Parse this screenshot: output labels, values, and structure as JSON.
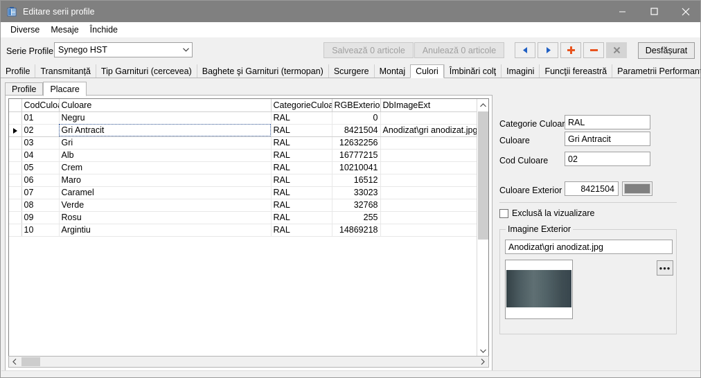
{
  "window": {
    "title": "Editare serii profile",
    "icon": "app-icon",
    "minimize": "minimize-icon",
    "maximize": "maximize-icon",
    "close": "close-icon"
  },
  "menubar": {
    "items": [
      {
        "label": "Diverse"
      },
      {
        "label": "Mesaje"
      },
      {
        "label": "Închide"
      }
    ]
  },
  "toolbar": {
    "serie_label": "Serie Profile:",
    "serie_value": "Synego HST",
    "save_label": "Salvează 0 articole",
    "cancel_label": "Anulează 0 articole",
    "nav_prev": "prev-record-icon",
    "nav_next": "next-record-icon",
    "nav_add": "add-record-icon",
    "nav_delete": "delete-record-icon",
    "nav_cancel": "cancel-edit-icon",
    "expand_label": "Desfășurat"
  },
  "tabs_outer": [
    {
      "label": "Profile",
      "active": false
    },
    {
      "label": "Transmitanță",
      "active": false
    },
    {
      "label": "Tip Garnituri (cercevea)",
      "active": false
    },
    {
      "label": "Baghete şi Garnituri (termopan)",
      "active": false
    },
    {
      "label": "Scurgere",
      "active": false
    },
    {
      "label": "Montaj",
      "active": false
    },
    {
      "label": "Culori",
      "active": true
    },
    {
      "label": "Îmbinări colţ",
      "active": false
    },
    {
      "label": "Imagini",
      "active": false
    },
    {
      "label": "Funcţii fereastră",
      "active": false
    },
    {
      "label": "Parametrii Performanţă",
      "active": false
    }
  ],
  "tabs_inner": [
    {
      "label": "Profile",
      "active": false
    },
    {
      "label": "Placare",
      "active": true
    }
  ],
  "grid": {
    "columns": [
      "CodCuloare",
      "Culoare",
      "CategorieCuloare",
      "RGBExterior",
      "DbImageExt"
    ],
    "rows": [
      {
        "cod": "01",
        "culoare": "Negru",
        "categorie": "RAL",
        "rgb": "0",
        "img": "",
        "selected": false
      },
      {
        "cod": "02",
        "culoare": "Gri Antracit",
        "categorie": "RAL",
        "rgb": "8421504",
        "img": "Anodizat\\gri anodizat.jpg",
        "selected": true
      },
      {
        "cod": "03",
        "culoare": "Gri",
        "categorie": "RAL",
        "rgb": "12632256",
        "img": "",
        "selected": false
      },
      {
        "cod": "04",
        "culoare": "Alb",
        "categorie": "RAL",
        "rgb": "16777215",
        "img": "",
        "selected": false
      },
      {
        "cod": "05",
        "culoare": "Crem",
        "categorie": "RAL",
        "rgb": "10210041",
        "img": "",
        "selected": false
      },
      {
        "cod": "06",
        "culoare": "Maro",
        "categorie": "RAL",
        "rgb": "16512",
        "img": "",
        "selected": false
      },
      {
        "cod": "07",
        "culoare": "Caramel",
        "categorie": "RAL",
        "rgb": "33023",
        "img": "",
        "selected": false
      },
      {
        "cod": "08",
        "culoare": "Verde",
        "categorie": "RAL",
        "rgb": "32768",
        "img": "",
        "selected": false
      },
      {
        "cod": "09",
        "culoare": "Rosu",
        "categorie": "RAL",
        "rgb": "255",
        "img": "",
        "selected": false
      },
      {
        "cod": "10",
        "culoare": "Argintiu",
        "categorie": "RAL",
        "rgb": "14869218",
        "img": "",
        "selected": false
      }
    ]
  },
  "details": {
    "categorie_label": "Categorie Culoare",
    "categorie_value": "RAL",
    "culoare_label": "Culoare",
    "culoare_value": "Gri Antracit",
    "cod_label": "Cod Culoare",
    "cod_value": "02",
    "exterior_label": "Culoare Exterior",
    "exterior_value": "8421504",
    "exterior_swatch_color": "#808080",
    "exclude_label": "Exclusă la vizualizare",
    "exclude_checked": false,
    "group_title": "Imagine Exterior",
    "image_path": "Anodizat\\gri anodizat.jpg",
    "browse_label": "•••"
  }
}
